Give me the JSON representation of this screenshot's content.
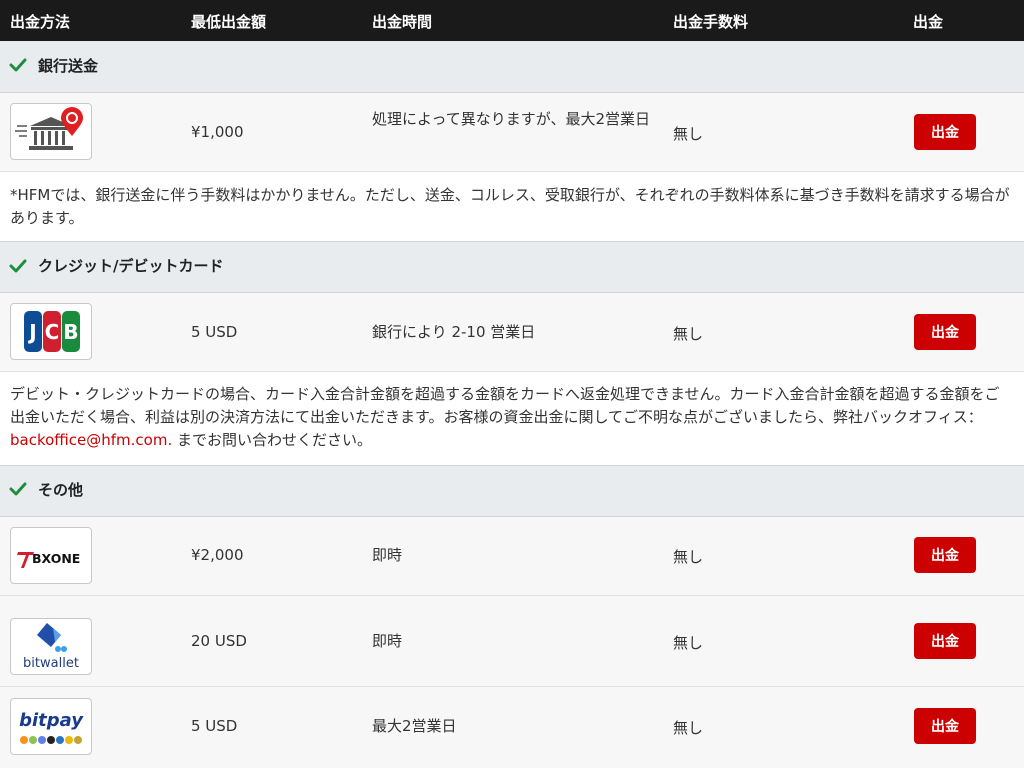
{
  "header": {
    "method": "出金方法",
    "minimum": "最低出金額",
    "time": "出金時間",
    "fee": "出金手数料",
    "withdraw": "出金"
  },
  "sections": {
    "bank": {
      "title": "銀行送金"
    },
    "card": {
      "title": "クレジット/デビットカード"
    },
    "other": {
      "title": "その他"
    }
  },
  "rows": {
    "bank": {
      "logo": "bank-pin-icon",
      "min": "¥1,000",
      "time": "処理によって異なりますが、最大2営業日",
      "fee": "無し",
      "button": "出金"
    },
    "jcb": {
      "logo_text": "JCB",
      "min": "5 USD",
      "time": "銀行により 2-10 営業日",
      "fee": "無し",
      "button": "出金"
    },
    "bxone": {
      "logo_text": "BXONE",
      "min": "¥2,000",
      "time": "即時",
      "fee": "無し",
      "button": "出金"
    },
    "bitwallet": {
      "logo_text": "bitwallet",
      "min": "20 USD",
      "time": "即時",
      "fee": "無し",
      "button": "出金"
    },
    "bitpay": {
      "logo_text": "bitpay",
      "min": "5 USD",
      "time": "最大2営業日",
      "fee": "無し",
      "button": "出金"
    }
  },
  "notes": {
    "bank": "*HFMでは、銀行送金に伴う手数料はかかりません。ただし、送金、コルレス、受取銀行が、それぞれの手数料体系に基づき手数料を請求する場合があります。",
    "card_prefix": "デビット・クレジットカードの場合、カード入金合計金額を超過する金額をカードへ返金処理できません。カード入金合計金額を超過する金額をご出金いただく場合、利益は別の決済方法にて出金いただきます。お客様の資金出金に関してご不明な点がございましたら、弊社バックオフィス：",
    "card_email": "backoffice@hfm.com.",
    "card_suffix": " までお問い合わせください。"
  },
  "colors": {
    "header_bg": "#1a1a1a",
    "accent_red": "#cc0000",
    "check_green": "#1e8e3e",
    "section_bg": "#e9ecef",
    "row_bg": "#f7f7f7"
  }
}
